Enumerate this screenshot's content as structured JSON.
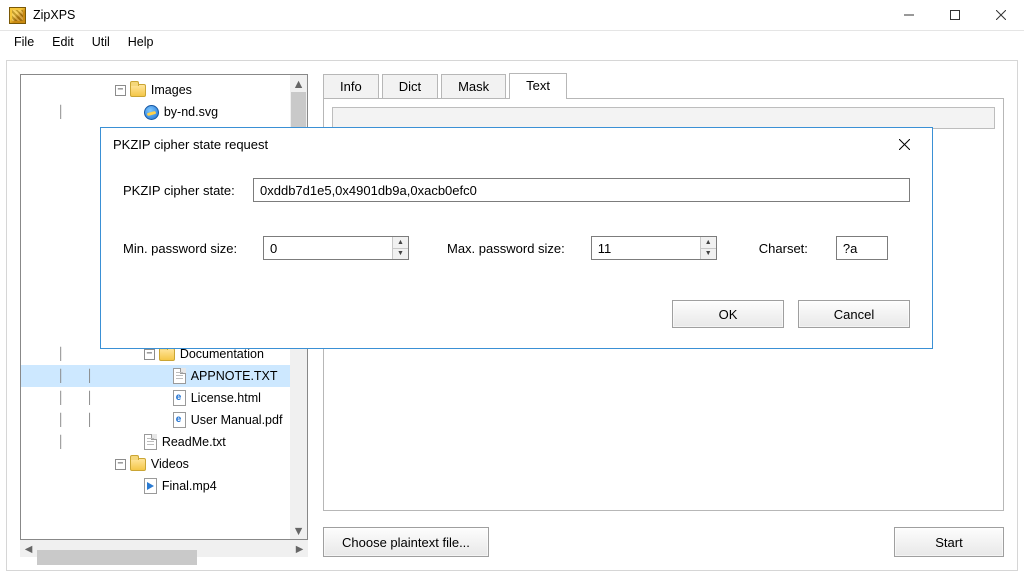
{
  "window": {
    "title": "ZipXPS"
  },
  "menubar": [
    "File",
    "Edit",
    "Util",
    "Help"
  ],
  "tree": {
    "items": [
      {
        "kind": "folder",
        "label": "Images",
        "expander": "−",
        "indent": 2,
        "prelines": "   "
      },
      {
        "kind": "ie",
        "label": "by-nd.svg",
        "indent": 3,
        "prelines": "   │   "
      },
      {
        "kind": "blank",
        "indent": 3
      },
      {
        "kind": "blank",
        "indent": 3
      },
      {
        "kind": "blank",
        "indent": 3
      },
      {
        "kind": "blank",
        "indent": 3
      },
      {
        "kind": "blank",
        "indent": 3
      },
      {
        "kind": "folder",
        "expander": "−",
        "indent": 2,
        "prelines": "   "
      },
      {
        "kind": "blank",
        "indent": 3
      },
      {
        "kind": "blank",
        "indent": 3
      },
      {
        "kind": "blank",
        "indent": 3
      },
      {
        "kind": "folder",
        "expander": "−",
        "indent": 2,
        "prelines": "   "
      },
      {
        "kind": "folder",
        "label": "Documentation",
        "expander": "−",
        "indent": 3,
        "prelines": "   │   "
      },
      {
        "kind": "txt",
        "label": "APPNOTE.TXT",
        "indent": 4,
        "prelines": "   │   │   ",
        "selected": true
      },
      {
        "kind": "ehtml",
        "label": "License.html",
        "indent": 4,
        "prelines": "   │   │   "
      },
      {
        "kind": "ehtml",
        "label": "User Manual.pdf",
        "indent": 4,
        "prelines": "   │   │   "
      },
      {
        "kind": "txt",
        "label": "ReadMe.txt",
        "indent": 3,
        "prelines": "   │   "
      },
      {
        "kind": "folder",
        "label": "Videos",
        "expander": "−",
        "indent": 2,
        "prelines": "   "
      },
      {
        "kind": "mp4",
        "label": "Final.mp4",
        "indent": 3,
        "prelines": "       "
      }
    ]
  },
  "tabs": {
    "items": [
      "Info",
      "Dict",
      "Mask",
      "Text"
    ],
    "selected": 3
  },
  "buttons": {
    "choose_plaintext": "Choose plaintext file...",
    "start": "Start"
  },
  "dialog": {
    "title": "PKZIP cipher state request",
    "cipher_label": "PKZIP cipher state:",
    "cipher_value": "0xddb7d1e5,0x4901db9a,0xacb0efc0",
    "min_label": "Min. password size:",
    "min_value": "0",
    "max_label": "Max. password size:",
    "max_value": "11",
    "charset_label": "Charset:",
    "charset_value": "?a",
    "ok": "OK",
    "cancel": "Cancel"
  }
}
